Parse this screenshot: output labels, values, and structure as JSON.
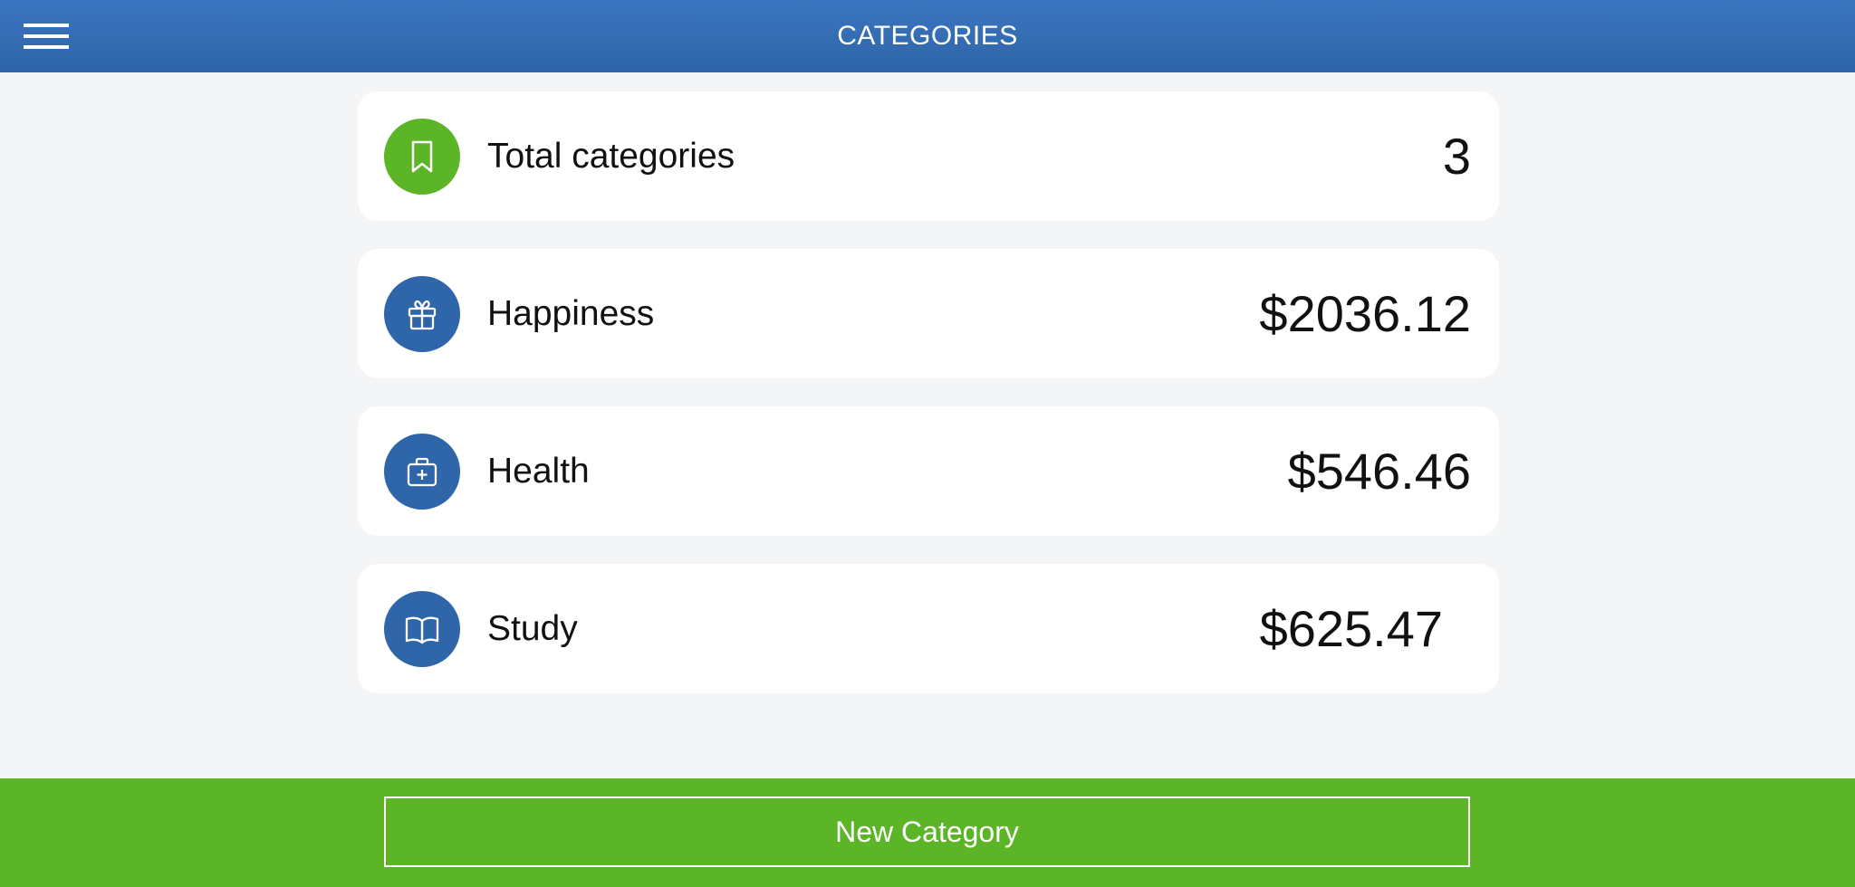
{
  "header": {
    "title": "CATEGORIES",
    "menu_icon": "hamburger-menu-icon",
    "background": "#3a76c0"
  },
  "summary": {
    "label": "Total categories",
    "value": "3",
    "icon": "bookmark-icon",
    "icon_color": "#5cb526"
  },
  "categories": [
    {
      "label": "Happiness",
      "value": "$2036.12",
      "icon": "gift-icon",
      "icon_color": "#2f65a9"
    },
    {
      "label": "Health",
      "value": "$546.46",
      "icon": "medical-kit-icon",
      "icon_color": "#2f65a9"
    },
    {
      "label": "Study",
      "value": "$625.47",
      "icon": "book-icon",
      "icon_color": "#2f65a9"
    }
  ],
  "footer": {
    "new_category_label": "New Category",
    "background": "#5cb526"
  }
}
